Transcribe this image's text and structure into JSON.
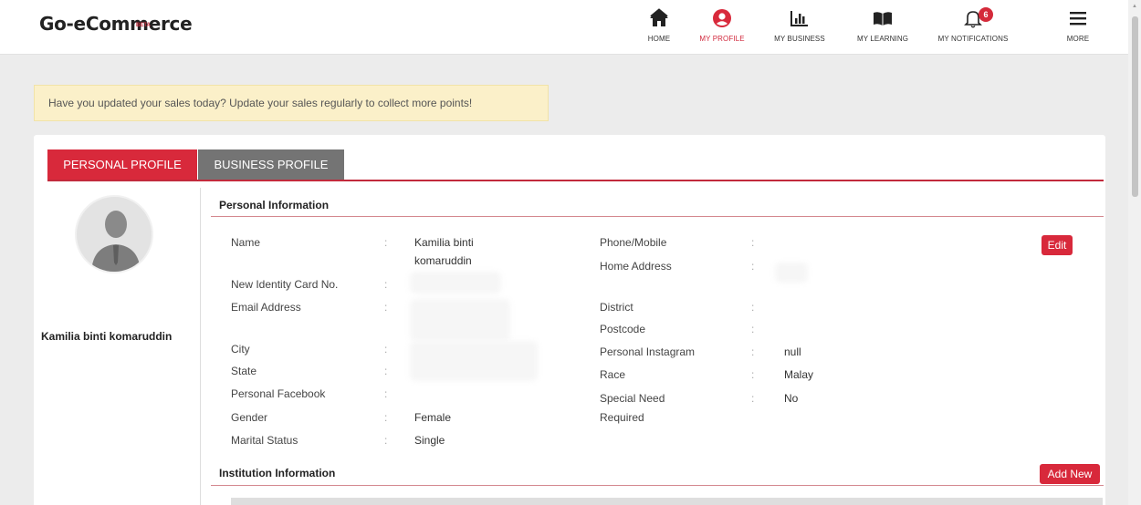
{
  "app": {
    "title": "Go-eCommerce",
    "beta": "BETA"
  },
  "nav": {
    "home": "HOME",
    "my_profile": "MY PROFILE",
    "my_business": "MY BUSINESS",
    "my_learning": "MY LEARNING",
    "my_notifications": "MY NOTIFICATIONS",
    "notifications_count": "6",
    "more": "MORE"
  },
  "alert": "Have you updated your sales today? Update your sales regularly to collect more points!",
  "tabs": {
    "personal": "PERSONAL PROFILE",
    "business": "BUSINESS PROFILE"
  },
  "user": {
    "name": "Kamilia binti komaruddin"
  },
  "personal_info": {
    "title": "Personal Information",
    "edit_label": "Edit",
    "separator": ":",
    "name_label": "Name",
    "name_value_line1": "Kamilia binti",
    "name_value_line2": "komaruddin",
    "ic_label": "New Identity Card No.",
    "email_label": "Email Address",
    "city_label": "City",
    "state_label": "State",
    "facebook_label": "Personal Facebook",
    "gender_label": "Gender",
    "gender_value": "Female",
    "marital_label": "Marital Status",
    "marital_value": "Single",
    "phone_label": "Phone/Mobile",
    "address_label": "Home Address",
    "district_label": "District",
    "postcode_label": "Postcode",
    "instagram_label": "Personal Instagram",
    "instagram_value": "null",
    "race_label": "Race",
    "race_value": "Malay",
    "special_need_label_line1": "Special Need",
    "special_need_label_line2": "Required",
    "special_need_value": "No"
  },
  "institution_info": {
    "title": "Institution Information",
    "add_new_label": "Add New"
  },
  "colors": {
    "accent": "#d8293b",
    "tab_inactive": "#747474",
    "alert_bg": "#fbf0c9"
  }
}
